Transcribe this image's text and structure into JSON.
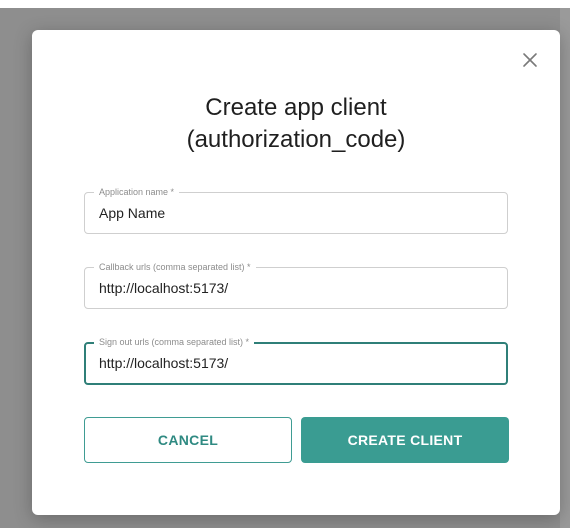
{
  "dialog": {
    "title_line1": "Create app client",
    "title_line2": "(authorization_code)",
    "close_icon": "close-icon"
  },
  "fields": [
    {
      "label": "Application name *",
      "value": "App Name"
    },
    {
      "label": "Callback urls (comma separated list) *",
      "value": "http://localhost:5173/"
    },
    {
      "label": "Sign out urls (comma separated list) *",
      "value": "http://localhost:5173/"
    }
  ],
  "buttons": {
    "cancel_label": "CANCEL",
    "create_label": "CREATE CLIENT"
  },
  "colors": {
    "accent": "#3a9c92",
    "accent_text": "#2f8a82",
    "backdrop": "#8e8e8e"
  }
}
